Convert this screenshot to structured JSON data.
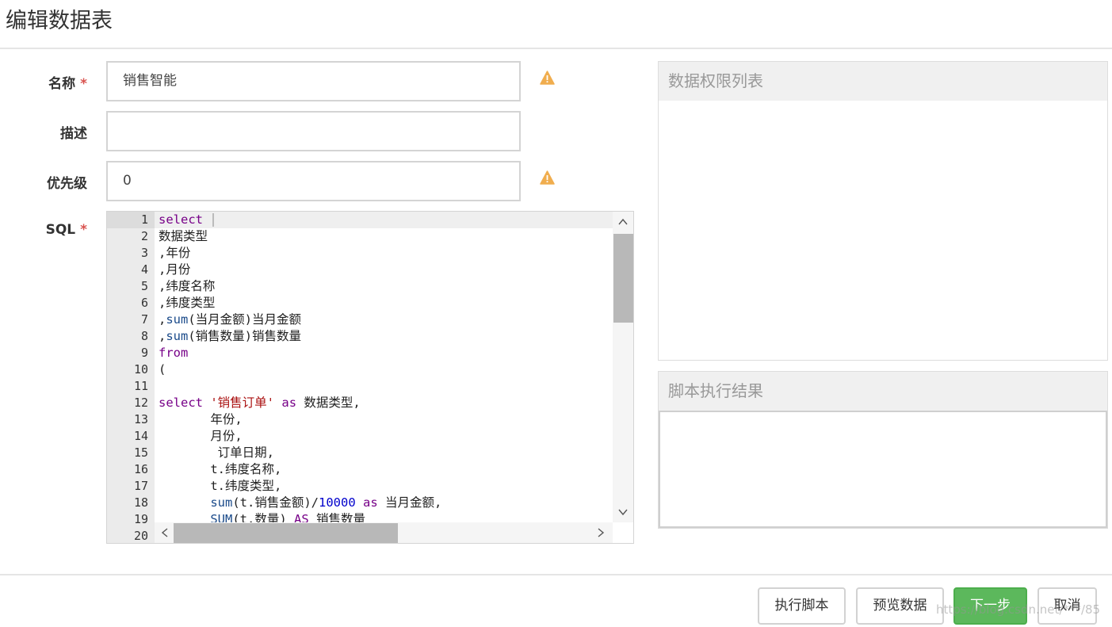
{
  "page": {
    "title": "编辑数据表"
  },
  "form": {
    "name_label": "名称",
    "name_required": "*",
    "name_value": "销售智能",
    "desc_label": "描述",
    "desc_value": "",
    "priority_label": "优先级",
    "priority_value": "0",
    "sql_label": "SQL",
    "sql_required": "*"
  },
  "icons": {
    "warning": "warning-triangle-icon",
    "up": "chevron-up-icon",
    "down": "chevron-down-icon",
    "left": "chevron-left-icon",
    "right": "chevron-right-icon"
  },
  "editor": {
    "line_numbers": [
      "1",
      "2",
      "3",
      "4",
      "5",
      "6",
      "7",
      "8",
      "9",
      "10",
      "11",
      "12",
      "13",
      "14",
      "15",
      "16",
      "17",
      "18",
      "19",
      "20"
    ],
    "lines": [
      {
        "parts": [
          {
            "t": "select",
            "c": "kw"
          },
          {
            "t": " ",
            "c": ""
          }
        ]
      },
      {
        "parts": [
          {
            "t": "数据类型",
            "c": ""
          }
        ]
      },
      {
        "parts": [
          {
            "t": ",年份",
            "c": ""
          }
        ]
      },
      {
        "parts": [
          {
            "t": ",月份",
            "c": ""
          }
        ]
      },
      {
        "parts": [
          {
            "t": ",纬度名称",
            "c": ""
          }
        ]
      },
      {
        "parts": [
          {
            "t": ",纬度类型",
            "c": ""
          }
        ]
      },
      {
        "parts": [
          {
            "t": ",",
            "c": ""
          },
          {
            "t": "sum",
            "c": "fn"
          },
          {
            "t": "(当月金额)当月金额",
            "c": ""
          }
        ]
      },
      {
        "parts": [
          {
            "t": ",",
            "c": ""
          },
          {
            "t": "sum",
            "c": "fn"
          },
          {
            "t": "(销售数量)销售数量",
            "c": ""
          }
        ]
      },
      {
        "parts": [
          {
            "t": "from",
            "c": "kw"
          }
        ]
      },
      {
        "parts": [
          {
            "t": "(",
            "c": ""
          }
        ]
      },
      {
        "parts": [
          {
            "t": "",
            "c": ""
          }
        ]
      },
      {
        "parts": [
          {
            "t": "select",
            "c": "kw"
          },
          {
            "t": " ",
            "c": ""
          },
          {
            "t": "'销售订单'",
            "c": "str"
          },
          {
            "t": " ",
            "c": ""
          },
          {
            "t": "as",
            "c": "kw"
          },
          {
            "t": " 数据类型,",
            "c": ""
          }
        ]
      },
      {
        "parts": [
          {
            "t": "       年份,",
            "c": ""
          }
        ]
      },
      {
        "parts": [
          {
            "t": "       月份,",
            "c": ""
          }
        ]
      },
      {
        "parts": [
          {
            "t": "        订单日期,",
            "c": ""
          }
        ]
      },
      {
        "parts": [
          {
            "t": "       t.纬度名称,",
            "c": ""
          }
        ]
      },
      {
        "parts": [
          {
            "t": "       t.纬度类型,",
            "c": ""
          }
        ]
      },
      {
        "parts": [
          {
            "t": "       ",
            "c": ""
          },
          {
            "t": "sum",
            "c": "fn"
          },
          {
            "t": "(t.销售金额)/",
            "c": ""
          },
          {
            "t": "10000",
            "c": "num2"
          },
          {
            "t": " ",
            "c": ""
          },
          {
            "t": "as",
            "c": "kw"
          },
          {
            "t": " 当月金额,",
            "c": ""
          }
        ]
      },
      {
        "parts": [
          {
            "t": "       ",
            "c": ""
          },
          {
            "t": "SUM",
            "c": "fn"
          },
          {
            "t": "(t.数量) ",
            "c": ""
          },
          {
            "t": "AS",
            "c": "kw"
          },
          {
            "t": " 销售数量",
            "c": ""
          }
        ]
      }
    ]
  },
  "panels": {
    "permissions_title": "数据权限列表",
    "result_title": "脚本执行结果"
  },
  "buttons": {
    "run_script": "执行脚本",
    "preview_data": "预览数据",
    "next_step": "下一步",
    "cancel": "取消"
  },
  "watermark": "https://blog.csdn.net/***/85",
  "colors": {
    "primary_button": "#5cb85c",
    "required": "#d9534f",
    "warning": "#f0ad4e"
  }
}
